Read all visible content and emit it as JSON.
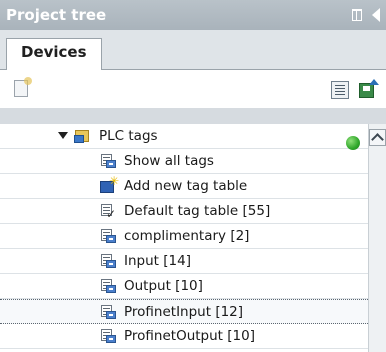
{
  "panel": {
    "title": "Project tree"
  },
  "tabs": [
    {
      "label": "Devices"
    }
  ],
  "tree": {
    "root": {
      "label": "PLC tags"
    },
    "items": [
      {
        "label": "Show all tags",
        "icon": "show-all-tags-icon"
      },
      {
        "label": "Add new tag table",
        "icon": "add-tag-table-icon"
      },
      {
        "label": "Default tag table [55]",
        "icon": "default-tag-table-icon"
      },
      {
        "label": "complimentary [2]",
        "icon": "tag-table-icon"
      },
      {
        "label": "Input [14]",
        "icon": "tag-table-icon"
      },
      {
        "label": "Output [10]",
        "icon": "tag-table-icon"
      },
      {
        "label": "ProfinetInput [12]",
        "icon": "tag-table-icon"
      },
      {
        "label": "ProfinetOutput [10]",
        "icon": "tag-table-icon"
      }
    ],
    "selected_index": 6
  },
  "colors": {
    "titlebar": "#a9b3bb",
    "status_ok": "#2fa62a",
    "tab_strip": "#dfe4e8"
  }
}
